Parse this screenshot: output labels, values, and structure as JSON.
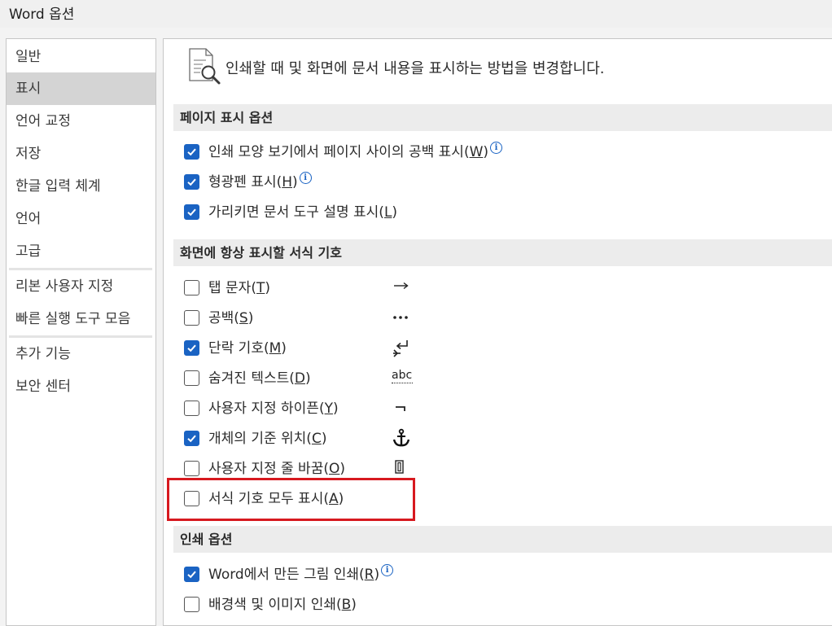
{
  "window": {
    "title": "Word 옵션"
  },
  "sidebar": {
    "items": [
      {
        "label": "일반",
        "selected": false
      },
      {
        "label": "표시",
        "selected": true
      },
      {
        "label": "언어 교정",
        "selected": false
      },
      {
        "label": "저장",
        "selected": false
      },
      {
        "label": "한글 입력 체계",
        "selected": false
      },
      {
        "label": "언어",
        "selected": false
      },
      {
        "label": "고급",
        "selected": false
      },
      {
        "label": "리본 사용자 지정",
        "selected": false
      },
      {
        "label": "빠른 실행 도구 모음",
        "selected": false
      },
      {
        "label": "추가 기능",
        "selected": false
      },
      {
        "label": "보안 센터",
        "selected": false
      }
    ]
  },
  "main": {
    "intro": "인쇄할 때 및 화면에 문서 내용을 표시하는 방법을 변경합니다.",
    "sections": {
      "page_display": {
        "title": "페이지 표시 옵션",
        "options": [
          {
            "text": "인쇄 모양 보기에서 페이지 사이의 공백 표시",
            "key": "W",
            "checked": true,
            "info": true
          },
          {
            "text": "형광펜 표시",
            "key": "H",
            "checked": true,
            "info": true
          },
          {
            "text": "가리키면 문서 도구 설명 표시",
            "key": "L",
            "checked": true,
            "info": false
          }
        ]
      },
      "formatting_marks": {
        "title": "화면에 항상 표시할 서식 기호",
        "options": [
          {
            "text": "탭 문자",
            "key": "T",
            "checked": false,
            "symbol": "tab-arrow-icon"
          },
          {
            "text": "공백",
            "key": "S",
            "checked": false,
            "symbol": "space-dots-icon"
          },
          {
            "text": "단락 기호",
            "key": "M",
            "checked": true,
            "symbol": "paragraph-mark-icon"
          },
          {
            "text": "숨겨진 텍스트",
            "key": "D",
            "checked": false,
            "symbol": "hidden-text-icon",
            "symbol_text": "abc"
          },
          {
            "text": "사용자 지정 하이픈",
            "key": "Y",
            "checked": false,
            "symbol": "optional-hyphen-icon"
          },
          {
            "text": "개체의 기준 위치",
            "key": "C",
            "checked": true,
            "symbol": "anchor-icon"
          },
          {
            "text": "사용자 지정 줄 바꿈",
            "key": "O",
            "checked": false,
            "symbol": "line-break-icon"
          },
          {
            "text": "서식 기호 모두 표시",
            "key": "A",
            "checked": false,
            "highlighted": true
          }
        ]
      },
      "print": {
        "title": "인쇄 옵션",
        "options": [
          {
            "text": "Word에서 만든 그림 인쇄",
            "key": "R",
            "checked": true,
            "info": true
          },
          {
            "text": "배경색 및 이미지 인쇄",
            "key": "B",
            "checked": false,
            "info": false
          }
        ]
      }
    }
  },
  "colors": {
    "checkbox_checked": "#1a63c3",
    "highlight_box": "#d7191f",
    "selected_nav": "#d4d4d4"
  }
}
